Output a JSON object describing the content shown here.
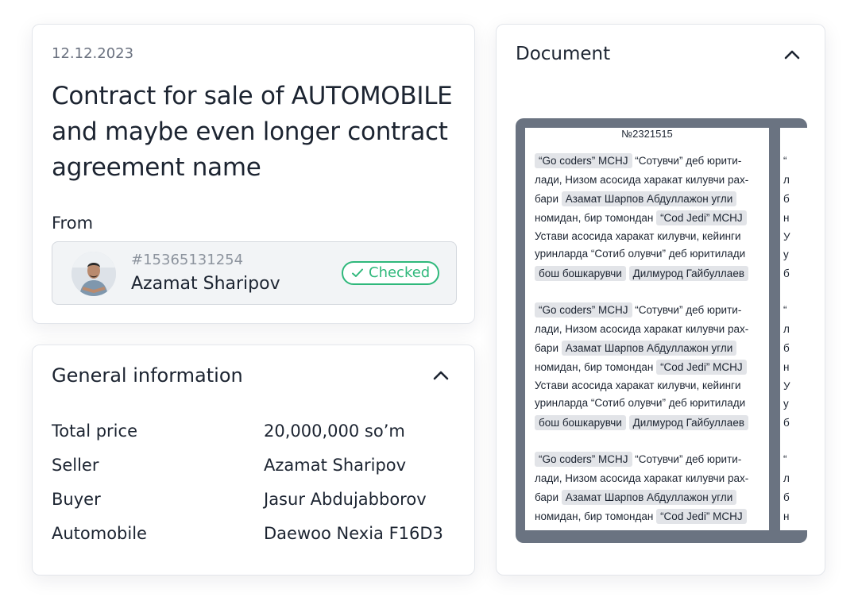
{
  "contract": {
    "date": "12.12.2023",
    "title": "Contract for sale of AUTOMOBILE and maybe even longer contract agreement name",
    "from_label": "From",
    "party": {
      "id": "#15365131254",
      "name": "Azamat Sharipov",
      "status": "Checked",
      "status_color": "#2fb87b"
    }
  },
  "general_info": {
    "title": "General information",
    "rows": [
      {
        "label": "Total price",
        "value": "20,000,000 so’m"
      },
      {
        "label": "Seller",
        "value": "Azamat Sharipov"
      },
      {
        "label": "Buyer",
        "value": "Jasur Abdujabborov"
      },
      {
        "label": "Automobile",
        "value": "Daewoo Nexia F16D3"
      }
    ]
  },
  "document": {
    "title": "Document",
    "page_number": "№2321515",
    "block": {
      "l1_tag": "“Go coders” MCHJ",
      "l1_text": "“Сотувчи” деб юрити-",
      "l2_text": "лади, Низом асосида харакат килувчи рах-",
      "l3_text": "бари",
      "l3_tag": "Азамат Шарпов Абдуллажон угли",
      "l4_text": "номидан, бир томондан",
      "l4_tag": "“Cod Jedi” MCHJ",
      "l5_text": "Устави асосида харакат килувчи, кейинги",
      "l6_text": "уринларда “Сотиб олувчи” деб юритилади",
      "l7_tag1": "бош бошкарувчи",
      "l7_tag2": "Дилмурод Гайбуллаев"
    },
    "page2_letters": [
      "“",
      "л",
      "б",
      "н",
      "У",
      "у",
      "б"
    ]
  }
}
